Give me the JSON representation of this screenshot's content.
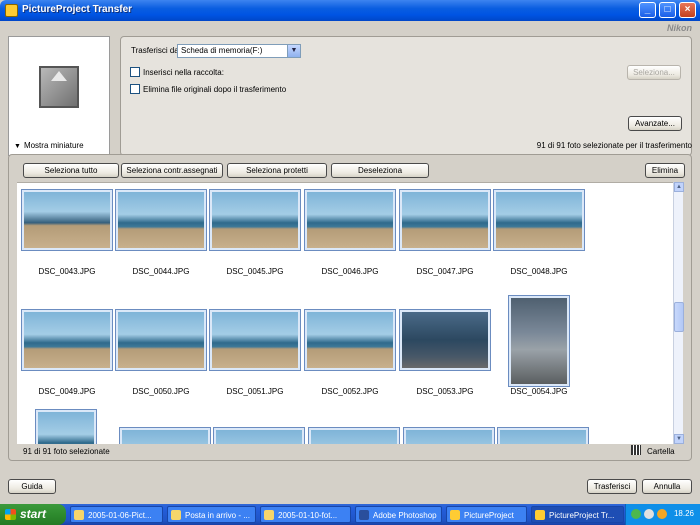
{
  "window": {
    "title": "PictureProject Transfer",
    "brand": "Nikon"
  },
  "options": {
    "source_label": "Trasferisci da:",
    "source_value": "Scheda di memoria(F:)",
    "add_to_collection_label": "Inserisci nella raccolta:",
    "delete_originals_label": "Elimina file originali dopo il trasferimento",
    "select_button": "Seleziona...",
    "advanced_button": "Avanzate..."
  },
  "thumbs_toggle": "Mostra miniature",
  "selection_summary": "91 di 91 foto selezionate per il trasferimento",
  "filters": {
    "select_all": "Seleziona tutto",
    "select_unassigned": "Seleziona contr.assegnati",
    "select_protected": "Seleziona protetti",
    "deselect": "Deseleziona",
    "delete": "Elimina"
  },
  "thumbnails": [
    {
      "name": "DSC_0043.JPG",
      "style": "portrait"
    },
    {
      "name": "DSC_0044.JPG",
      "style": "beach"
    },
    {
      "name": "DSC_0045.JPG",
      "style": "beach"
    },
    {
      "name": "DSC_0046.JPG",
      "style": "beach"
    },
    {
      "name": "DSC_0047.JPG",
      "style": "beach"
    },
    {
      "name": "DSC_0048.JPG",
      "style": "beach"
    },
    {
      "name": "DSC_0049.JPG",
      "style": "beach"
    },
    {
      "name": "DSC_0050.JPG",
      "style": "beach"
    },
    {
      "name": "DSC_0051.JPG",
      "style": "beach"
    },
    {
      "name": "DSC_0052.JPG",
      "style": "beach"
    },
    {
      "name": "DSC_0053.JPG",
      "style": "dark"
    },
    {
      "name": "DSC_0054.JPG",
      "style": "village"
    }
  ],
  "status": {
    "count": "91 di 91 foto selezionate",
    "folder": "Cartella"
  },
  "bottom": {
    "help": "Guida",
    "transfer": "Trasferisci",
    "cancel": "Annulla"
  },
  "taskbar": {
    "start": "start",
    "tasks": [
      "2005-01-06-Pict...",
      "Posta in arrivo - ...",
      "2005-01-10-fot...",
      "Adobe Photoshop",
      "PictureProject",
      "PictureProject Tr..."
    ],
    "clock": "18.26"
  }
}
